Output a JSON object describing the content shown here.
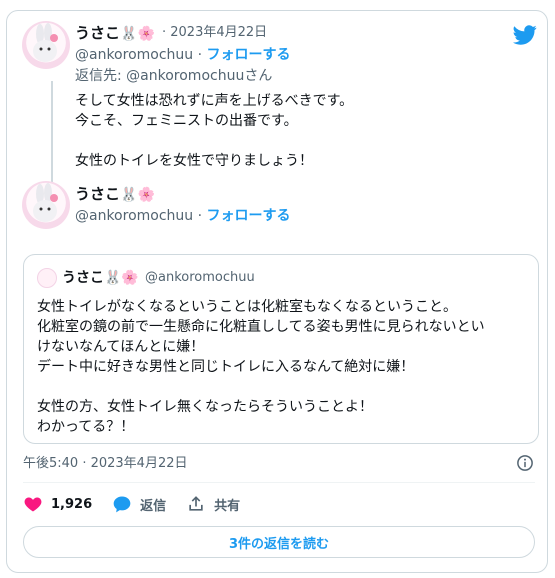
{
  "reply_tweet": {
    "display_name": "うさこ",
    "name_emojis": "🐰🌸",
    "date": "2023年4月22日",
    "handle": "@ankoromochuu",
    "follow_label": "フォローする",
    "reply_to_prefix": "返信先: ",
    "reply_to_handle": "@ankoromochuu",
    "reply_to_suffix": "さん",
    "text": "そして女性は恐れずに声を上げるべきです。\n今こそ、フェミニストの出番です。\n\n女性のトイレを女性で守りましょう！"
  },
  "main_tweet": {
    "display_name": "うさこ",
    "name_emojis": "🐰🌸",
    "handle": "@ankoromochuu",
    "follow_label": "フォローする"
  },
  "quoted_tweet": {
    "display_name": "うさこ",
    "name_emojis": "🐰🌸",
    "handle": "@ankoromochuu",
    "text": "女性トイレがなくなるということは化粧室もなくなるということ。\n化粧室の鏡の前で一生懸命に化粧直ししてる姿も男性に見られないとい\nけないなんてほんとに嫌！\nデート中に好きな男性と同じトイレに入るなんて絶対に嫌！\n\n女性の方、女性トイレ無くなったらそういうことよ！\nわかってる？！"
  },
  "timestamp": "午後5:40 · 2023年4月22日",
  "actions": {
    "likes": "1,926",
    "reply_label": "返信",
    "share_label": "共有"
  },
  "read_replies_label": "3件の返信を読む",
  "colors": {
    "accent": "#1d9bf0",
    "like": "#f91880",
    "border": "#cfd9de",
    "muted": "#536471"
  },
  "icons": [
    "twitter-bird-icon",
    "heart-icon",
    "reply-bubble-icon",
    "share-icon",
    "info-icon"
  ]
}
